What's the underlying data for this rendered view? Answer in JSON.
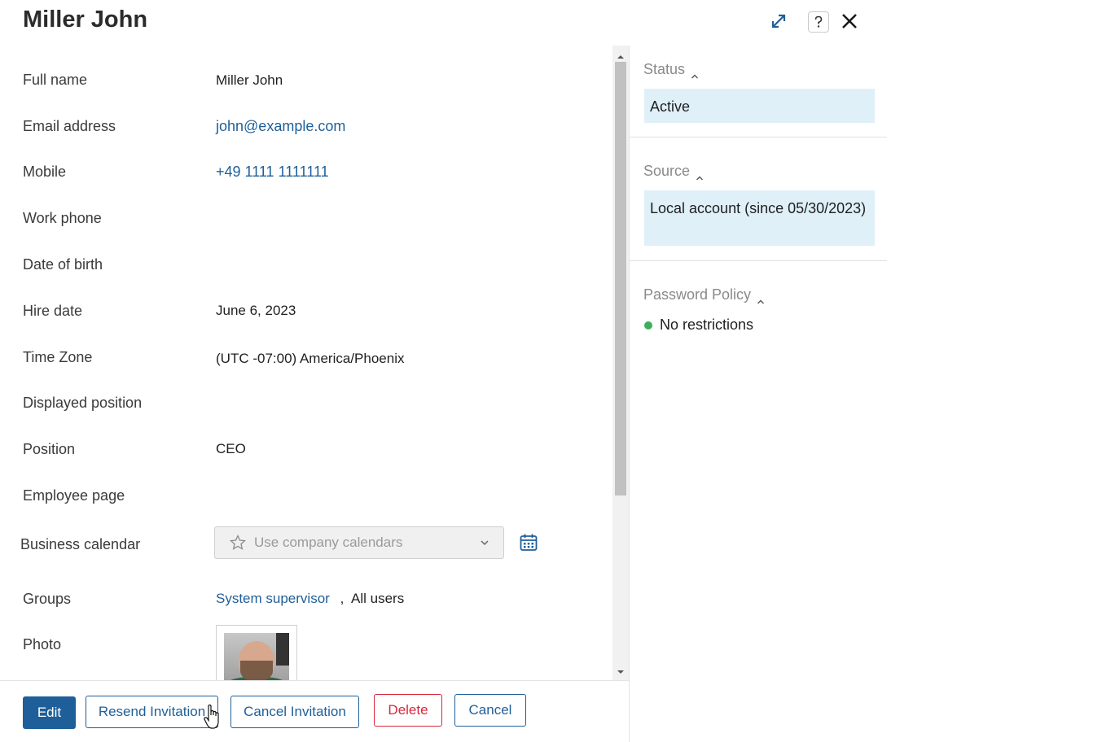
{
  "header": {
    "title": "Miller John"
  },
  "fields": [
    {
      "label": "Full name",
      "value": "Miller John"
    },
    {
      "label": "Email address",
      "value": "john@example.com"
    },
    {
      "label": "Mobile",
      "value": "+49 1111 1111111"
    },
    {
      "label": "Work phone",
      "value": ""
    },
    {
      "label": "Date of birth",
      "value": ""
    },
    {
      "label": "Hire date",
      "value": "June 6, 2023"
    },
    {
      "label": "Time Zone",
      "value": "(UTC -07:00) America/Phoenix"
    },
    {
      "label": "Displayed position",
      "value": ""
    },
    {
      "label": "Position",
      "value": "CEO"
    },
    {
      "label": "Employee page",
      "value": ""
    },
    {
      "label": "Business calendar",
      "placeholder": "Use company calendars"
    },
    {
      "label": "Groups",
      "group_link": "System supervisor",
      "separator": ",",
      "group_plain": "All users"
    },
    {
      "label": "Photo"
    }
  ],
  "footer": {
    "edit": "Edit",
    "resend": "Resend Invitation",
    "cancel_invitation": "Cancel Invitation",
    "delete": "Delete",
    "cancel": "Cancel"
  },
  "side": {
    "status_title": "Status",
    "status_value": "Active",
    "source_title": "Source",
    "source_value": "Local account (since 05/30/2023)",
    "policy_title": "Password Policy",
    "policy_value": "No restrictions"
  },
  "colors": {
    "accent": "#1f5f99",
    "danger": "#d9273d",
    "side_box": "#dff0f8",
    "policy_ok": "#3fae5a"
  }
}
